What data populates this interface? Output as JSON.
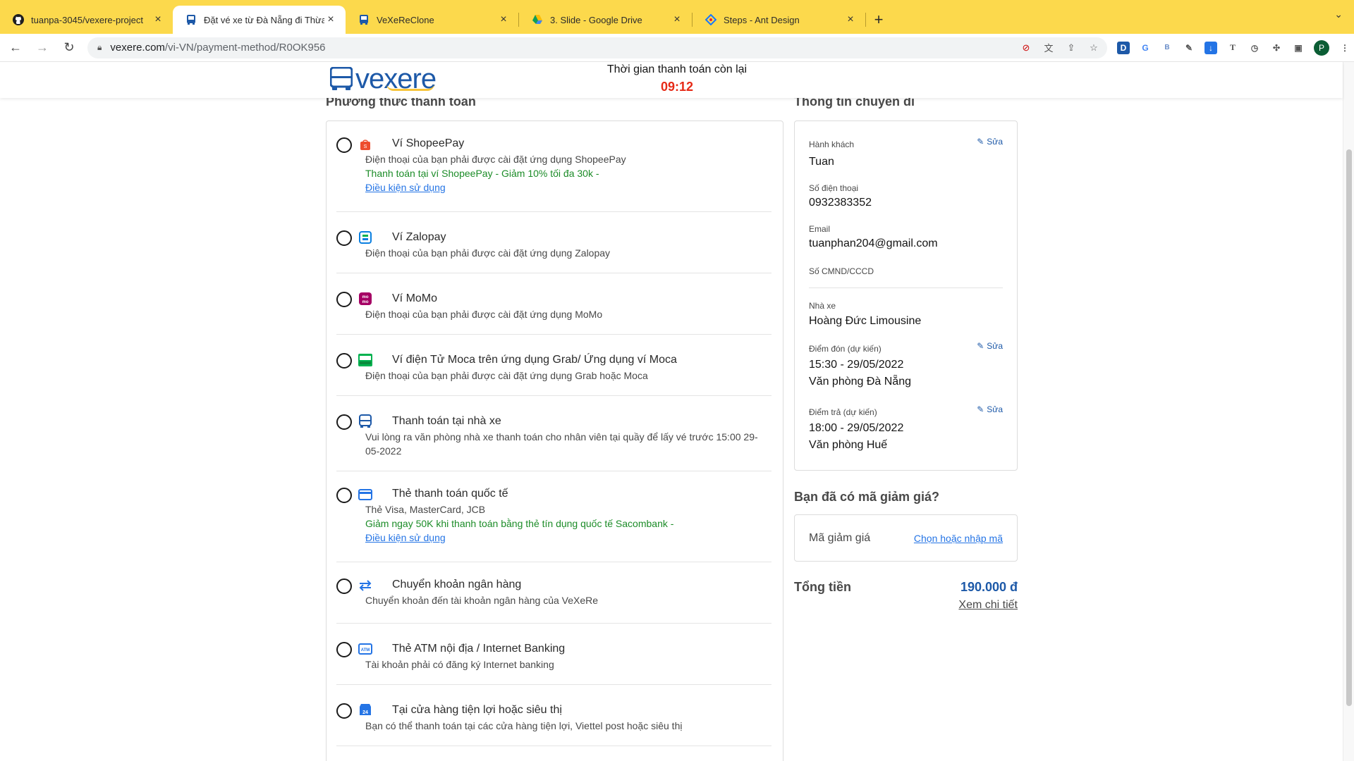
{
  "browser": {
    "tabs": [
      {
        "title": "tuanpa-3045/vexere-project",
        "icon": "github-icon",
        "active": false
      },
      {
        "title": "Đặt vé xe từ Đà Nẵng đi Thừa Thiên Huế",
        "icon": "vexere-bus-icon",
        "active": true
      },
      {
        "title": "VeXeReClone",
        "icon": "vexere-bus-icon",
        "active": false
      },
      {
        "title": "3. Slide - Google Drive",
        "icon": "google-drive-icon",
        "active": false
      },
      {
        "title": "Steps - Ant Design",
        "icon": "ant-design-icon",
        "active": false
      }
    ],
    "url_host": "vexere.com",
    "url_path": "/vi-VN/payment-method/R0OK956",
    "profile_initial": "P"
  },
  "header": {
    "timer_label": "Thời gian thanh toán còn lại",
    "timer_value": "09:12"
  },
  "payment": {
    "title": "Phương thức thanh toán",
    "methods": [
      {
        "name": "Ví ShopeePay",
        "desc": "Điện thoại của bạn phải được cài đặt ứng dụng ShopeePay",
        "promo": "Thanh toán tại ví ShopeePay - Giảm 10% tối đa 30k -",
        "terms": "Điều kiện sử dụng",
        "icon": "shopeepay-icon"
      },
      {
        "name": "Ví Zalopay",
        "desc": "Điện thoại của bạn phải được cài đặt ứng dụng Zalopay",
        "icon": "zalopay-icon"
      },
      {
        "name": "Ví MoMo",
        "desc": "Điện thoại của bạn phải được cài đặt ứng dụng MoMo",
        "icon": "momo-icon"
      },
      {
        "name": "Ví điện Tử Moca trên ứng dụng Grab/ Ứng dụng ví Moca",
        "desc": "Điện thoại của bạn phải được cài đặt ứng dụng Grab hoặc Moca",
        "icon": "moca-icon"
      },
      {
        "name": "Thanh toán tại nhà xe",
        "desc": "Vui lòng ra văn phòng nhà xe thanh toán cho nhân viên tại quầy để lấy vé trước 15:00 29-05-2022",
        "icon": "bus-icon"
      },
      {
        "name": "Thẻ thanh toán quốc tế",
        "desc": "Thẻ Visa, MasterCard, JCB",
        "promo": "Giảm ngay 50K khi thanh toán bằng thẻ tín dụng quốc tế Sacombank -",
        "terms": "Điều kiện sử dụng",
        "icon": "credit-card-icon"
      },
      {
        "name": "Chuyển khoản ngân hàng",
        "desc": "Chuyển khoản đến tài khoản ngân hàng của VeXeRe",
        "icon": "bank-transfer-icon"
      },
      {
        "name": "Thẻ ATM nội địa / Internet Banking",
        "desc": "Tài khoản phải có đăng ký Internet banking",
        "icon": "atm-card-icon"
      },
      {
        "name": "Tại cửa hàng tiện lợi hoặc siêu thị",
        "desc": "Bạn có thể thanh toán tại các cửa hàng tiện lợi, Viettel post hoặc siêu thị",
        "icon": "store-24h-icon"
      }
    ]
  },
  "trip": {
    "title": "Thông tin chuyến đi",
    "edit_label": "Sửa",
    "passenger_label": "Hành khách",
    "passenger": "Tuan",
    "phone_label": "Số điện thoại",
    "phone": "0932383352",
    "email_label": "Email",
    "email": "tuanphan204@gmail.com",
    "id_label": "Số CMND/CCCD",
    "operator_label": "Nhà xe",
    "operator": "Hoàng Đức Limousine",
    "pickup_label": "Điểm đón (dự kiến)",
    "pickup_time": "15:30 - 29/05/2022",
    "pickup_place": "Văn phòng Đà Nẵng",
    "dropoff_label": "Điểm trả (dự kiến)",
    "dropoff_time": "18:00 - 29/05/2022",
    "dropoff_place": "Văn phòng Huế"
  },
  "coupon": {
    "title": "Bạn đã có mã giảm giá?",
    "label": "Mã giảm giá",
    "action": "Chọn hoặc nhập mã"
  },
  "total": {
    "label": "Tổng tiền",
    "value": "190.000 đ",
    "detail": "Xem chi tiết"
  }
}
